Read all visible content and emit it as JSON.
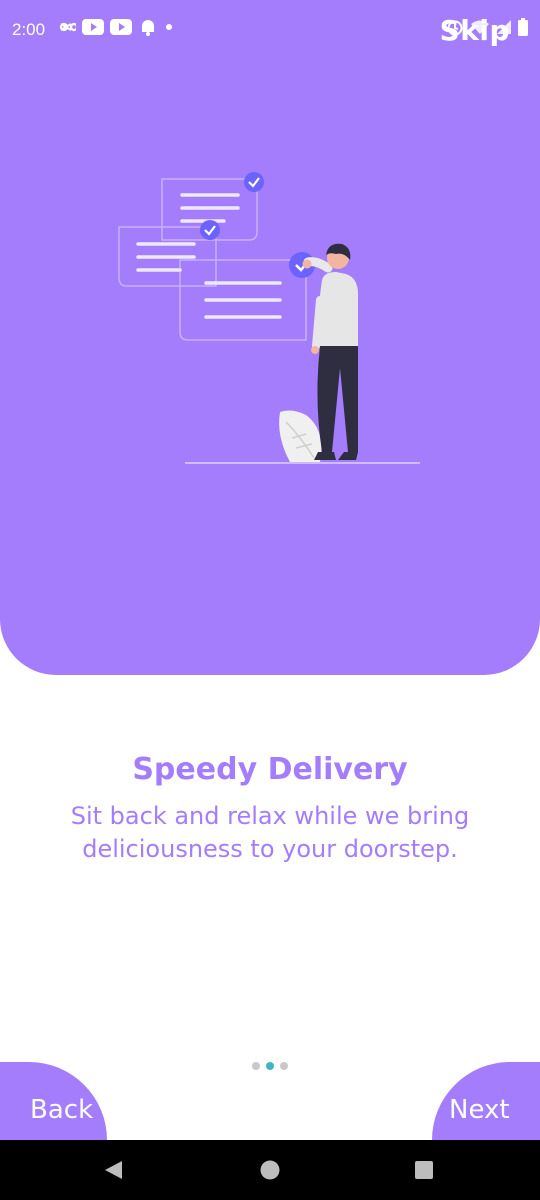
{
  "status_bar": {
    "time": "2:00",
    "icons_left": [
      "infinity-icon",
      "youtube-icon",
      "youtube-icon",
      "notification-bell-icon",
      "dot-icon"
    ],
    "icons_right": [
      "alarm-icon",
      "wifi-icon",
      "signal-icon",
      "battery-icon"
    ]
  },
  "header": {
    "skip_label": "Skip"
  },
  "onboarding": {
    "title": "Speedy Delivery",
    "subtitle": "Sit back and relax while we bring deliciousness to your doorstep.",
    "page_count": 3,
    "current_page": 2
  },
  "footer": {
    "back_label": "Back",
    "next_label": "Next"
  },
  "navigation_bar": {
    "buttons": [
      "back-triangle-icon",
      "home-circle-icon",
      "recents-square-icon"
    ]
  },
  "colors": {
    "primary": "#a47dfc",
    "accent": "#3fb5c0",
    "dot_inactive": "#c8c8c8",
    "on_primary": "#ffffff",
    "illustration_accent": "#6c63ff"
  }
}
